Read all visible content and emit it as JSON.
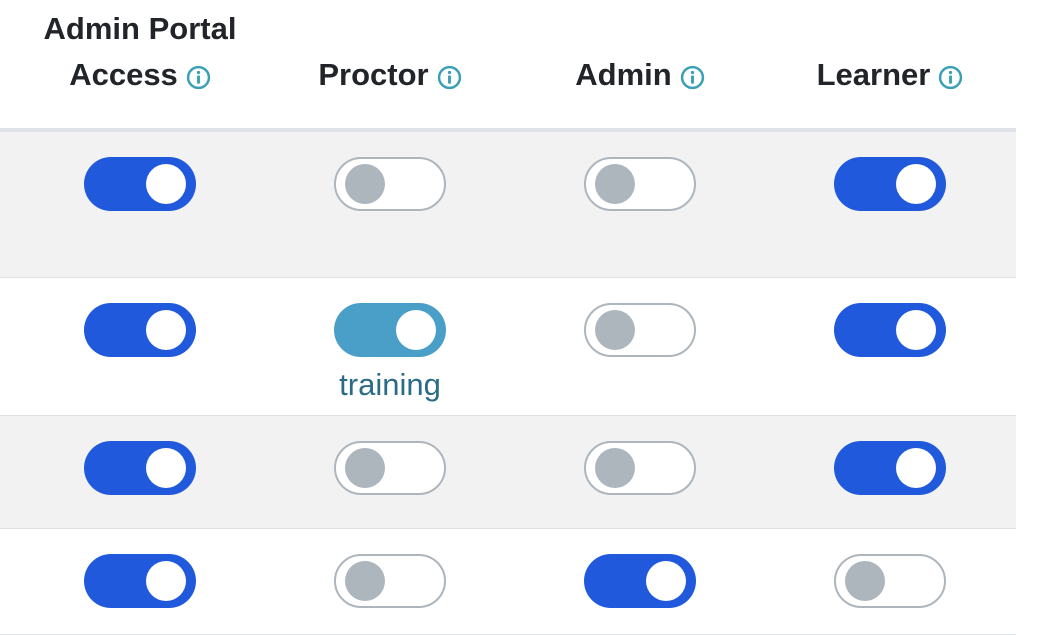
{
  "columns": [
    {
      "line1": "Admin Portal",
      "line2": "Access",
      "info_icon": "info-circle-icon"
    },
    {
      "line1": "",
      "line2": "Proctor",
      "info_icon": "info-circle-icon"
    },
    {
      "line1": "",
      "line2": "Admin",
      "info_icon": "info-circle-icon"
    },
    {
      "line1": "",
      "line2": "Learner",
      "info_icon": "info-circle-icon"
    }
  ],
  "rows": [
    {
      "cells": [
        {
          "on": true
        },
        {
          "on": false
        },
        {
          "on": false
        },
        {
          "on": true
        }
      ]
    },
    {
      "cells": [
        {
          "on": true
        },
        {
          "on": true,
          "variant": "training",
          "note": "training"
        },
        {
          "on": false
        },
        {
          "on": true
        }
      ]
    },
    {
      "cells": [
        {
          "on": true
        },
        {
          "on": false
        },
        {
          "on": false
        },
        {
          "on": true
        }
      ]
    },
    {
      "cells": [
        {
          "on": true
        },
        {
          "on": false
        },
        {
          "on": true
        },
        {
          "on": false
        }
      ]
    }
  ],
  "colors": {
    "toggle_on": "#2159dc",
    "toggle_training": "#4a9fc9",
    "toggle_off_knob": "#adb5bd",
    "info_icon": "#3aa0b5",
    "note_text": "#2a6b87",
    "stripe": "#f2f2f2"
  }
}
